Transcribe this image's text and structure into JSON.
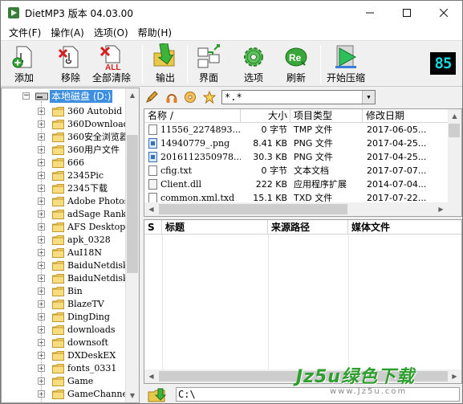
{
  "window": {
    "title": "DietMP3  版本 04.03.00"
  },
  "menu": [
    "文件(F)",
    "操作(A)",
    "选项(O)",
    "帮助(H)"
  ],
  "toolbar": {
    "add": "添加",
    "remove": "移除",
    "clear_all": "全部清除",
    "output": "输出",
    "interface": "界面",
    "options": "选项",
    "refresh": "刷新",
    "start": "开始压缩",
    "lcd": "85"
  },
  "tree": {
    "root": "本地磁盘 (D:)",
    "items": [
      "360 Autobid",
      "360Downloads",
      "360安全浏览器",
      "360用户文件",
      "666",
      "2345Pic",
      "2345下载",
      "Adobe Photos!",
      "adSage RankH",
      "AFS Desktop",
      "apk_0328",
      "AuI18N",
      "BaiduNetdisk",
      "BaiduNetdisk",
      "Bin",
      "BlazeTV",
      "DingDing",
      "downloads",
      "downsoft",
      "DXDeskEX",
      "fonts_0331",
      "Game",
      "GameChannel '",
      "GameChannelD"
    ]
  },
  "filter": {
    "value": "*.*"
  },
  "filelist": {
    "columns": [
      "名称  /",
      "大小",
      "项目类型",
      "修改日期"
    ],
    "rows": [
      {
        "name": "11556_2274893...",
        "size": "0 字节",
        "type": "TMP 文件",
        "date": "2017-06-05...",
        "icon": "file"
      },
      {
        "name": "14940779_.png",
        "size": "8.41 KB",
        "type": "PNG 文件",
        "date": "2017-04-25...",
        "icon": "png"
      },
      {
        "name": "2016112350978...",
        "size": "30.3 KB",
        "type": "PNG 文件",
        "date": "2017-04-25...",
        "icon": "png"
      },
      {
        "name": "cfig.txt",
        "size": "0 字节",
        "type": "文本文档",
        "date": "2017-07-07...",
        "icon": "file"
      },
      {
        "name": "Client.dll",
        "size": "222 KB",
        "type": "应用程序扩展",
        "date": "2014-07-04...",
        "icon": "dll"
      },
      {
        "name": "common.xml.txd",
        "size": "15.1 KB",
        "type": "TXD 文件",
        "date": "2017-07-22...",
        "icon": "file"
      },
      {
        "name": "Config.rdb",
        "size": "199 KB",
        "type": "RDB 文件",
        "date": "2017-03-06...",
        "icon": "file"
      }
    ]
  },
  "queue": {
    "columns": [
      "S",
      "标题",
      "来源路径",
      "媒体文件"
    ]
  },
  "output_dir": {
    "path": "C:\\"
  },
  "watermark": {
    "main": "Jz5u绿色下载",
    "sub": "www.Jz5u.com"
  }
}
